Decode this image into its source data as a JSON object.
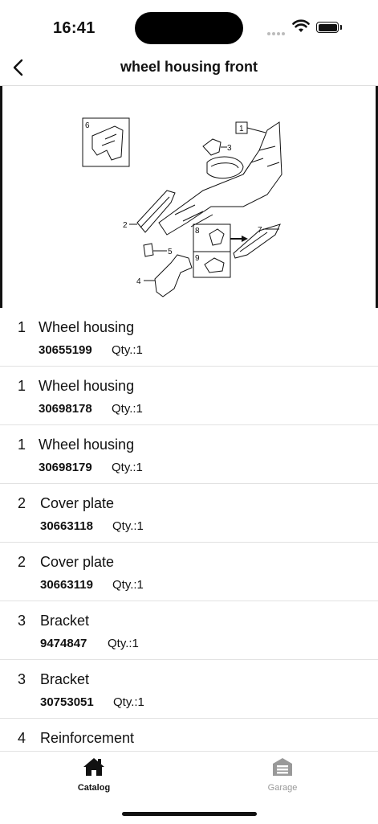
{
  "status_bar": {
    "time": "16:41"
  },
  "header": {
    "title": "wheel housing front"
  },
  "diagram": {
    "callouts": [
      "1",
      "2",
      "3",
      "4",
      "5",
      "6",
      "7",
      "8",
      "9"
    ]
  },
  "parts": [
    {
      "pos": "1",
      "name": "Wheel housing",
      "part_number": "30655199",
      "qty": "Qty.:1"
    },
    {
      "pos": "1",
      "name": "Wheel housing",
      "part_number": "30698178",
      "qty": "Qty.:1"
    },
    {
      "pos": "1",
      "name": "Wheel housing",
      "part_number": "30698179",
      "qty": "Qty.:1"
    },
    {
      "pos": "2",
      "name": "Cover plate",
      "part_number": "30663118",
      "qty": "Qty.:1"
    },
    {
      "pos": "2",
      "name": "Cover plate",
      "part_number": "30663119",
      "qty": "Qty.:1"
    },
    {
      "pos": "3",
      "name": "Bracket",
      "part_number": "9474847",
      "qty": "Qty.:1"
    },
    {
      "pos": "3",
      "name": "Bracket",
      "part_number": "30753051",
      "qty": "Qty.:1"
    },
    {
      "pos": "4",
      "name": "Reinforcement",
      "part_number": "",
      "qty": ""
    }
  ],
  "tabs": [
    {
      "label": "Catalog",
      "icon": "home-icon",
      "active": true
    },
    {
      "label": "Garage",
      "icon": "garage-icon",
      "active": false
    }
  ]
}
